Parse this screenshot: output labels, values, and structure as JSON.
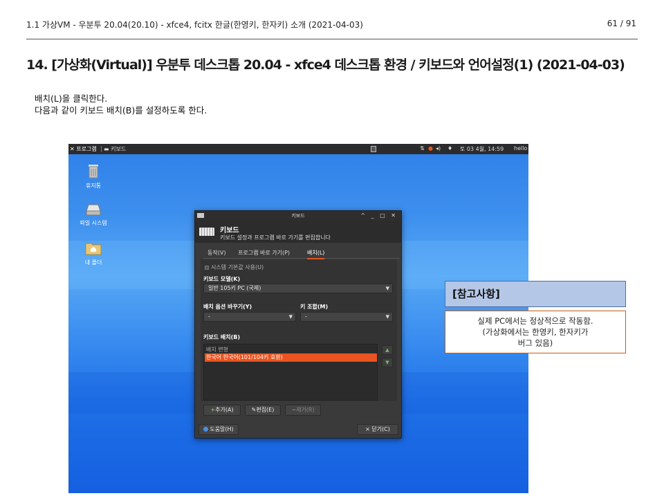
{
  "header": {
    "left": "1.1 가상VM - 우분투 20.04(20.10) - xfce4, fcitx 한글(한영키, 한자키) 소개 (2021-04-03)",
    "page": "61 / 91"
  },
  "title": "14. [가상화(Virtual)] 우분투 데스크톱 20.04 - xfce4 데스크톱 환경 / 키보드와 언어설정(1) (2021-04-03)",
  "body": {
    "line1": "배치(L)을 클릭한다.",
    "line2": "다음과 같이 키보드 배치(B)를 설정하도록 한다."
  },
  "taskbar": {
    "menu": "✕ 프로그램",
    "window": "키보드",
    "date": "토 03  4월, 14:59",
    "user": "hello"
  },
  "desktop_icons": [
    {
      "label": "휴지통",
      "icon": "trash-icon"
    },
    {
      "label": "파일 시스템",
      "icon": "drive-icon"
    },
    {
      "label": "내 폴더",
      "icon": "home-folder-icon"
    }
  ],
  "dialog": {
    "window_title": "키보드",
    "window_buttons": "^ _ □ ✕",
    "name": "키보드",
    "subtitle": "키보드 설정과 프로그램 바로 가기를 편집합니다",
    "tabs": [
      "동작(V)",
      "프로그램 바로 가기(P)",
      "배치(L)"
    ],
    "active_tab": "배치(L)",
    "system_default": "시스템 기본값 사용(U)",
    "model_label": "키보드 모델(K)",
    "model_value": "일반 105키 PC (국제)",
    "switch_label": "배치 옵션 바꾸기(Y)",
    "switch_value": "-",
    "compose_label": "키 조합(M)",
    "compose_value": "-",
    "layout_label": "키보드 배치(B)",
    "list_header": "배치    변형",
    "list_row": "한국어  한국어(101/104키 호환)",
    "add_button": "추가(A)",
    "edit_button": "편집(E)",
    "remove_button": "제거(R)",
    "help_button": "도움말(H)",
    "close_button": "닫기(C)"
  },
  "callout": {
    "title": "[참고사항]",
    "line1": "실제 PC에서는 정상적으로 작동함.",
    "line2": "(가상화에서는 한영키, 한자키가",
    "line3": "버그 있음)"
  },
  "colors": {
    "accent": "#e95420",
    "callout_title_bg": "#b4c7e7",
    "callout_border": "#c55a11",
    "desktop_blue": "#2f80e8"
  }
}
